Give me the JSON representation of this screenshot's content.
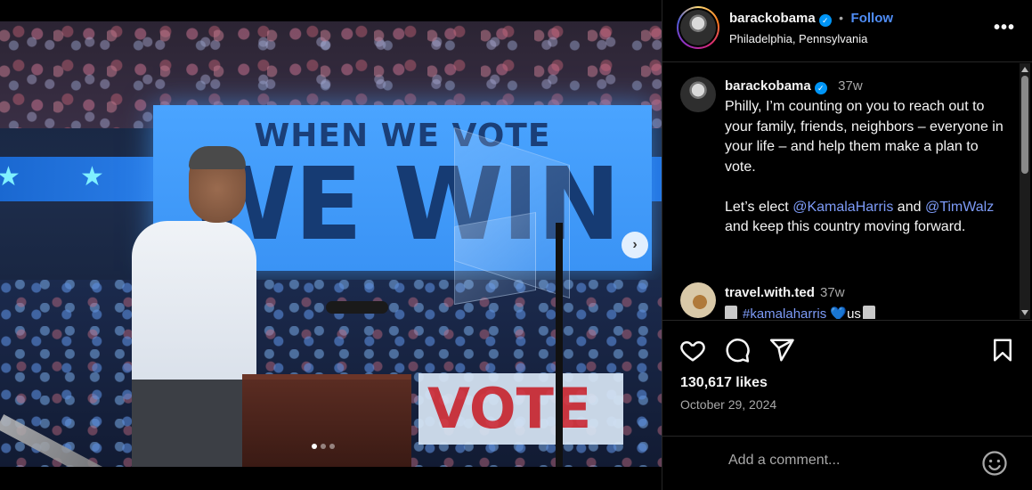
{
  "post": {
    "username": "barackobama",
    "location": "Philadelphia, Pennsylvania",
    "follow_label": "Follow",
    "separator": "•",
    "more_label": "•••"
  },
  "image": {
    "banner_top": "WHEN WE VOTE",
    "banner_main": "WE WIN",
    "sign_text": "VOTE",
    "carousel_count": 3,
    "carousel_active": 1
  },
  "caption": {
    "username": "barackobama",
    "time": "37w",
    "line1": "Philly, I’m counting on you to reach out to your family, friends, neighbors – everyone in your life – and help them make a plan to vote.",
    "line2_pre": "Let’s elect ",
    "mention1": "@KamalaHarris",
    "line2_mid": " and ",
    "mention2": "@TimWalz",
    "line2_post": " and keep this country moving forward."
  },
  "comment2": {
    "username": "travel.with.ted",
    "time": "37w",
    "hashtag": "#kamalaharris",
    "emoji": "💙",
    "text_tail": "us"
  },
  "stats": {
    "likes": "130,617 likes",
    "date": "October 29, 2024"
  },
  "comment_box": {
    "placeholder": "Add a comment..."
  },
  "colors": {
    "accent": "#4f8df6",
    "mention": "#7d9bf7",
    "verified": "#0095f6"
  }
}
